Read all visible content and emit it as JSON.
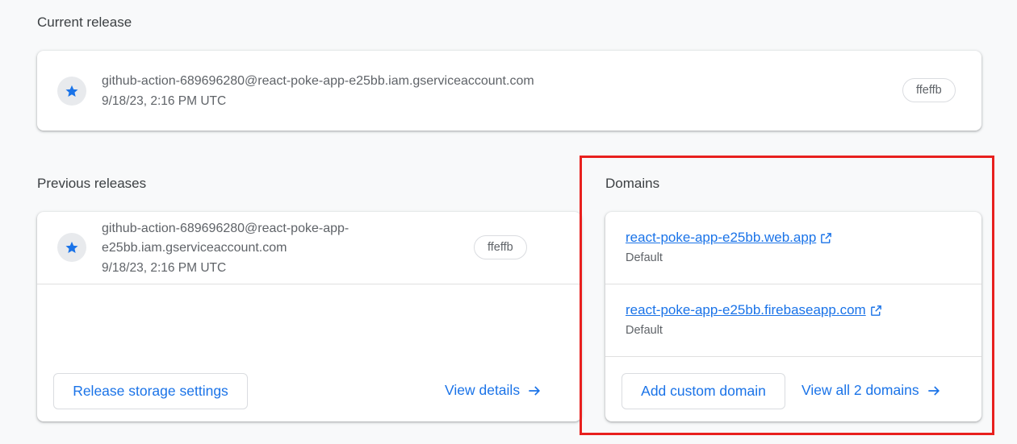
{
  "current_release": {
    "title": "Current release",
    "account": "github-action-689696280@react-poke-app-e25bb.iam.gserviceaccount.com",
    "timestamp": "9/18/23, 2:16 PM UTC",
    "version_chip": "ffeffb"
  },
  "previous_releases": {
    "title": "Previous releases",
    "account_line1": "github-action-689696280@react-poke-app-",
    "account_line2": "e25bb.iam.gserviceaccount.com",
    "timestamp": "9/18/23, 2:16 PM UTC",
    "version_chip": "ffeffb",
    "storage_button": "Release storage settings",
    "view_details": "View details"
  },
  "domains": {
    "title": "Domains",
    "items": [
      {
        "url": "react-poke-app-e25bb.web.app",
        "label": "Default"
      },
      {
        "url": "react-poke-app-e25bb.firebaseapp.com",
        "label": "Default"
      }
    ],
    "add_custom_domain": "Add custom domain",
    "view_all": "View all 2 domains"
  },
  "colors": {
    "accent": "#1a73e8",
    "highlight": "#e8201e",
    "background": "#f8f9fa"
  }
}
